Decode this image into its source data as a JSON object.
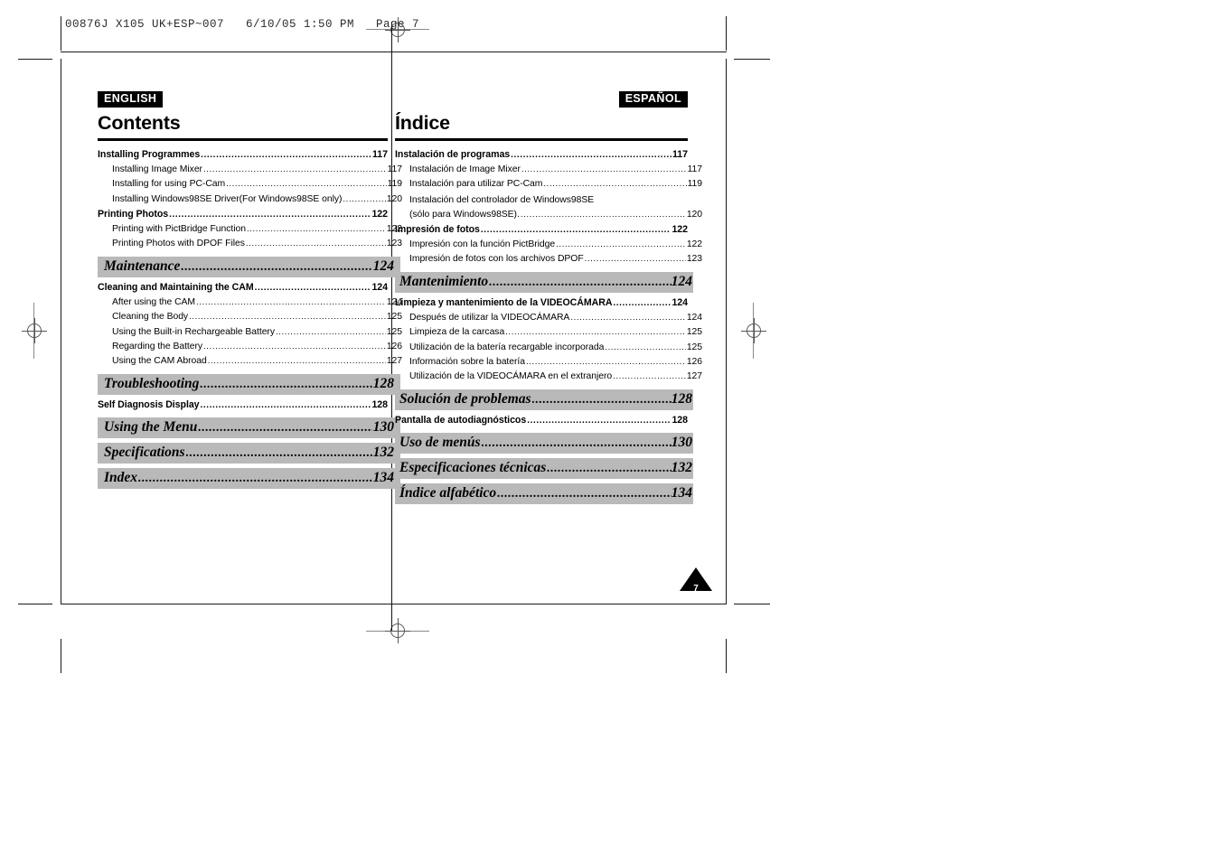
{
  "print_slug": "00876J X105 UK+ESP~007   6/10/05 1:50 PM   Page 7",
  "folio": {
    "page_number": "7"
  },
  "colors": {
    "band_gray": "#b9b9b9",
    "badge_black": "#000000",
    "rule_black": "#000000"
  },
  "english": {
    "badge": "ENGLISH",
    "title": "Contents",
    "entries": [
      {
        "level": 1,
        "label": "Installing Programmes",
        "page": "117"
      },
      {
        "level": 2,
        "label": "Installing Image Mixer",
        "page": "117"
      },
      {
        "level": 2,
        "label": "Installing for using PC-Cam",
        "page": "119"
      },
      {
        "level": 2,
        "label": "Installing Windows98SE Driver(For Windows98SE only)",
        "page": "120"
      },
      {
        "level": 1,
        "label": "Printing Photos",
        "page": "122"
      },
      {
        "level": 2,
        "label": "Printing with PictBridge Function",
        "page": "122"
      },
      {
        "level": 2,
        "label": "Printing Photos with DPOF Files",
        "page": "123"
      },
      {
        "level": 0,
        "label": "Maintenance",
        "page": "124"
      },
      {
        "level": 1,
        "label": "Cleaning and Maintaining the CAM",
        "page": "124"
      },
      {
        "level": 2,
        "label": "After using the CAM",
        "page": "124"
      },
      {
        "level": 2,
        "label": "Cleaning the Body",
        "page": "125"
      },
      {
        "level": 2,
        "label": "Using the Built-in Rechargeable Battery",
        "page": "125"
      },
      {
        "level": 2,
        "label": "Regarding the Battery",
        "page": "126"
      },
      {
        "level": 2,
        "label": "Using the CAM Abroad",
        "page": "127"
      },
      {
        "level": 0,
        "label": "Troubleshooting",
        "page": "128"
      },
      {
        "level": 1,
        "label": "Self Diagnosis Display",
        "page": "128"
      },
      {
        "level": 0,
        "label": "Using the Menu",
        "page": "130"
      },
      {
        "level": 0,
        "label": "Specifications",
        "page": "132"
      },
      {
        "level": 0,
        "label": "Index",
        "page": "134"
      }
    ]
  },
  "spanish": {
    "badge": "ESPAÑOL",
    "title": "Índice",
    "entries": [
      {
        "level": 1,
        "label": "Instalación de programas",
        "page": "117"
      },
      {
        "level": 2,
        "label": "Instalación de Image Mixer",
        "page": "117"
      },
      {
        "level": 2,
        "label": "Instalación para utilizar PC-Cam",
        "page": "119"
      },
      {
        "level": 3,
        "label": "Instalación del controlador de Windows98SE"
      },
      {
        "level": 2,
        "label": "(sólo para Windows98SE).",
        "page": "120"
      },
      {
        "level": 1,
        "label": "Impresión de fotos",
        "page": "122"
      },
      {
        "level": 2,
        "label": "Impresión con la función PictBridge",
        "page": "122"
      },
      {
        "level": 2,
        "label": "Impresión de fotos con los archivos DPOF",
        "page": "123"
      },
      {
        "level": 0,
        "label": "Mantenimiento",
        "page": "124"
      },
      {
        "level": 1,
        "label": "Limpieza y mantenimiento de la VIDEOCÁMARA",
        "page": "124"
      },
      {
        "level": 2,
        "label": "Después de utilizar la VIDEOCÁMARA",
        "page": "124"
      },
      {
        "level": 2,
        "label": "Limpieza de la carcasa",
        "page": "125"
      },
      {
        "level": 2,
        "label": "Utilización de la batería recargable incorporada",
        "page": "125"
      },
      {
        "level": 2,
        "label": "Información sobre la batería",
        "page": "126"
      },
      {
        "level": 2,
        "label": "Utilización de la VIDEOCÁMARA en el extranjero",
        "page": "127"
      },
      {
        "level": 0,
        "label": "Solución de problemas",
        "page": "128"
      },
      {
        "level": 1,
        "label": "Pantalla de autodiagnósticos",
        "page": "128"
      },
      {
        "level": 0,
        "label": "Uso de menús",
        "page": "130"
      },
      {
        "level": 0,
        "label": "Especificaciones técnicas",
        "page": "132"
      },
      {
        "level": 0,
        "label": "Índice alfabético",
        "page": "134"
      }
    ]
  }
}
